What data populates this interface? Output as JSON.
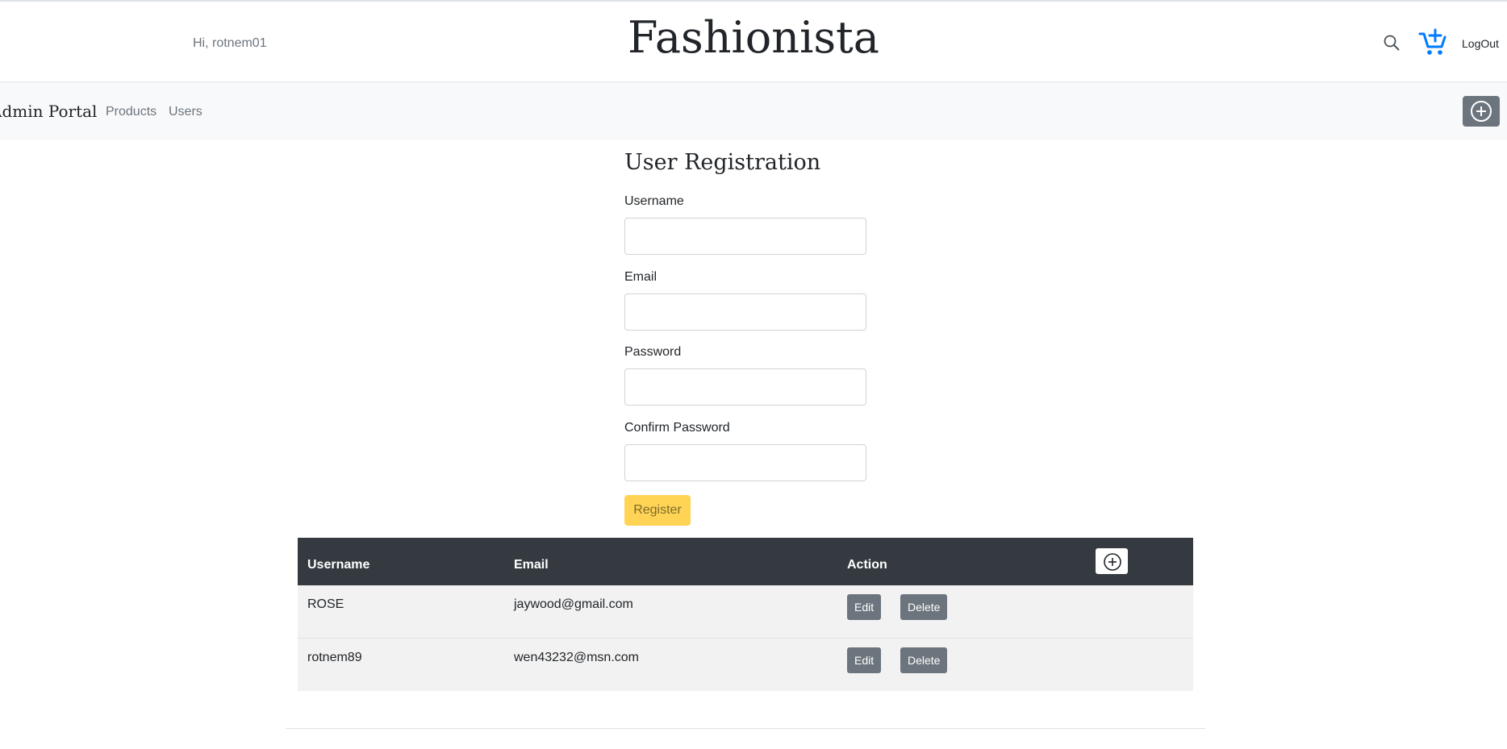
{
  "header": {
    "greeting": "Hi, rotnem01",
    "brand": "Fashionista",
    "logout_label": "LogOut",
    "icons": [
      "search-icon",
      "add-to-cart-icon"
    ],
    "cart_icon_color": "#007bff"
  },
  "admin_nav": {
    "brand": "Admin Portal",
    "links": [
      "Products",
      "Users"
    ],
    "add_icon": "plus-circle-icon"
  },
  "registration_form": {
    "title": "User Registration",
    "fields": [
      {
        "label": "Username",
        "value": "",
        "placeholder": ""
      },
      {
        "label": "Email",
        "value": "",
        "placeholder": ""
      },
      {
        "label": "Password",
        "value": "",
        "placeholder": ""
      },
      {
        "label": "Confirm Password",
        "value": "",
        "placeholder": ""
      }
    ],
    "submit_label": "Register",
    "submit_color": "#ffd455"
  },
  "users_table": {
    "columns": [
      "Username",
      "Email",
      "Action"
    ],
    "header_color": "#343a40",
    "add_icon": "plus-circle-icon",
    "rows": [
      {
        "username": "ROSE",
        "email": "jaywood@gmail.com",
        "actions": [
          "Edit",
          "Delete"
        ]
      },
      {
        "username": "rotnem89",
        "email": "wen43232@msn.com",
        "actions": [
          "Edit",
          "Delete"
        ]
      }
    ]
  }
}
